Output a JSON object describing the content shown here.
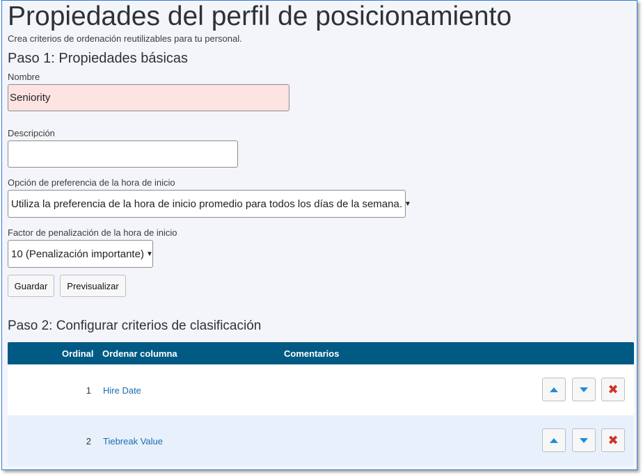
{
  "page": {
    "title": "Propiedades del perfil de posicionamiento",
    "subtitle": "Crea criterios de ordenación reutilizables para tu personal."
  },
  "step1": {
    "heading": "Paso 1: Propiedades básicas",
    "name_label": "Nombre",
    "name_value": "Seniority",
    "description_label": "Descripción",
    "description_value": "",
    "start_pref_label": "Opción de preferencia de la hora de inicio",
    "start_pref_value": "Utiliza la preferencia de la hora de inicio promedio para todos los días de la semana.",
    "penalty_label": "Factor de penalización de la hora de inicio",
    "penalty_value": "10 (Penalización importante)",
    "save_label": "Guardar",
    "preview_label": "Previsualizar"
  },
  "step2": {
    "heading": "Paso 2: Configurar criterios de clasificación",
    "columns": {
      "ordinal": "Ordinal",
      "sort_column": "Ordenar columna",
      "comments": "Comentarios"
    },
    "rows": [
      {
        "ordinal": "1",
        "column": "Hire Date",
        "comment": ""
      },
      {
        "ordinal": "2",
        "column": "Tiebreak Value",
        "comment": ""
      }
    ]
  },
  "icons": {
    "move_up": "triangle-up-icon",
    "move_down": "triangle-down-icon",
    "delete": "x-icon"
  },
  "colors": {
    "header_bg": "#005a84",
    "link": "#1a6bb0",
    "invalid_field": "#fde3e1",
    "delete_icon": "#d0312d",
    "arrow_icon": "#1c8ed6"
  }
}
